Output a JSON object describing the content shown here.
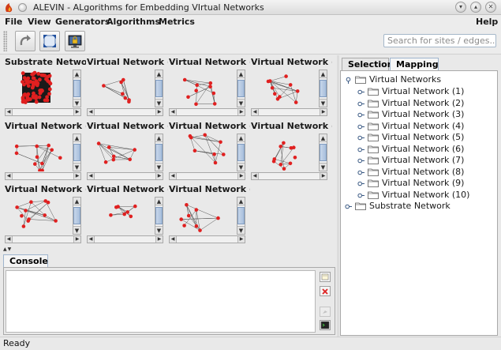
{
  "window": {
    "title": "ALEVIN - ALgorithms for Embedding VIrtual Networks",
    "controls": [
      "minimize-icon",
      "maximize-icon",
      "close-icon"
    ]
  },
  "menubar": {
    "items": [
      {
        "label": "File"
      },
      {
        "label": "View"
      },
      {
        "label": "Generators"
      },
      {
        "label": "Algorithms"
      },
      {
        "label": "Metrics"
      },
      {
        "label": "Help"
      }
    ]
  },
  "toolbar": {
    "buttons": [
      "redo-icon",
      "fit-screen-icon",
      "lock-monitor-icon"
    ],
    "search_placeholder": "Search for sites / edges..."
  },
  "networks": [
    {
      "label": "Substrate Network"
    },
    {
      "label": "Virtual Network (1)"
    },
    {
      "label": "Virtual Network (2)"
    },
    {
      "label": "Virtual Network (3)"
    },
    {
      "label": "Virtual Network (4)"
    },
    {
      "label": "Virtual Network (5)"
    },
    {
      "label": "Virtual Network (6)"
    },
    {
      "label": "Virtual Network (7)"
    },
    {
      "label": "Virtual Network (8)"
    },
    {
      "label": "Virtual Network (9)"
    },
    {
      "label": "Virtual Network (10)"
    }
  ],
  "console": {
    "tab_label": "Console",
    "text": ""
  },
  "right_panel": {
    "tabs": [
      {
        "label": "Selection"
      },
      {
        "label": "Mapping",
        "active": true
      }
    ],
    "tree": {
      "root": "Virtual Networks",
      "children": [
        "Virtual Network (1)",
        "Virtual Network (2)",
        "Virtual Network (3)",
        "Virtual Network (4)",
        "Virtual Network (5)",
        "Virtual Network (6)",
        "Virtual Network (7)",
        "Virtual Network (8)",
        "Virtual Network (9)",
        "Virtual Network (10)"
      ],
      "sibling": "Substrate Network"
    }
  },
  "status": {
    "text": "Ready"
  },
  "colors": {
    "node": "#e02020",
    "edge": "#555555",
    "accent": "#9fb4cd"
  }
}
